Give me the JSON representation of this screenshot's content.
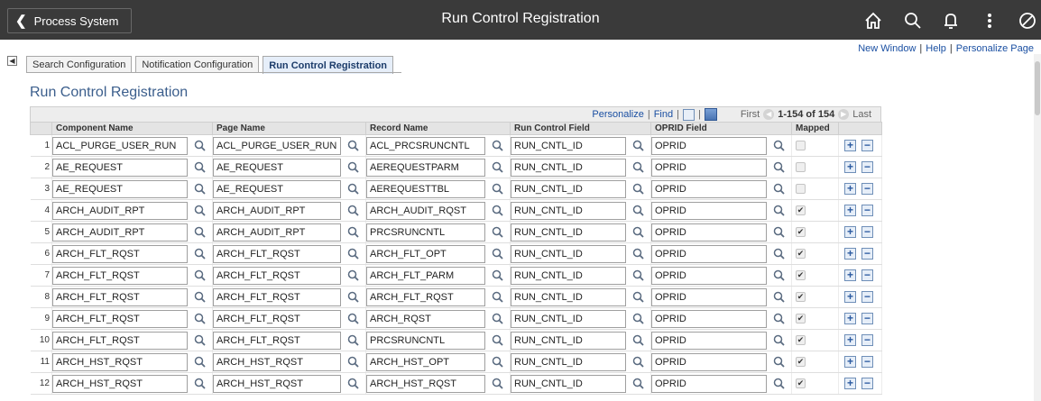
{
  "banner": {
    "back_label": "Process System",
    "title": "Run Control Registration",
    "icons": [
      "home-icon",
      "search-icon",
      "notification-bell-icon",
      "actions-menu-icon",
      "navbar-icon"
    ]
  },
  "page_links": {
    "new_window": "New Window",
    "help": "Help",
    "personalize_page": "Personalize Page"
  },
  "tabs": [
    {
      "label": "Search Configuration",
      "active": false
    },
    {
      "label": "Notification Configuration",
      "active": false
    },
    {
      "label": "Run Control Registration",
      "active": true
    }
  ],
  "heading": "Run Control Registration",
  "grid_nav": {
    "personalize": "Personalize",
    "find": "Find",
    "first": "First",
    "count": "1-154 of 154",
    "last": "Last"
  },
  "columns": [
    "Component Name",
    "Page Name",
    "Record Name",
    "Run Control Field",
    "OPRID Field",
    "Mapped"
  ],
  "rows": [
    {
      "num": "1",
      "component": "ACL_PURGE_USER_RUN",
      "page": "ACL_PURGE_USER_RUN",
      "record": "ACL_PRCSRUNCNTL",
      "runcntl": "RUN_CNTL_ID",
      "oprid": "OPRID",
      "mapped": false
    },
    {
      "num": "2",
      "component": "AE_REQUEST",
      "page": "AE_REQUEST",
      "record": "AEREQUESTPARM",
      "runcntl": "RUN_CNTL_ID",
      "oprid": "OPRID",
      "mapped": false
    },
    {
      "num": "3",
      "component": "AE_REQUEST",
      "page": "AE_REQUEST",
      "record": "AEREQUESTTBL",
      "runcntl": "RUN_CNTL_ID",
      "oprid": "OPRID",
      "mapped": false
    },
    {
      "num": "4",
      "component": "ARCH_AUDIT_RPT",
      "page": "ARCH_AUDIT_RPT",
      "record": "ARCH_AUDIT_RQST",
      "runcntl": "RUN_CNTL_ID",
      "oprid": "OPRID",
      "mapped": true
    },
    {
      "num": "5",
      "component": "ARCH_AUDIT_RPT",
      "page": "ARCH_AUDIT_RPT",
      "record": "PRCSRUNCNTL",
      "runcntl": "RUN_CNTL_ID",
      "oprid": "OPRID",
      "mapped": true
    },
    {
      "num": "6",
      "component": "ARCH_FLT_RQST",
      "page": "ARCH_FLT_RQST",
      "record": "ARCH_FLT_OPT",
      "runcntl": "RUN_CNTL_ID",
      "oprid": "OPRID",
      "mapped": true
    },
    {
      "num": "7",
      "component": "ARCH_FLT_RQST",
      "page": "ARCH_FLT_RQST",
      "record": "ARCH_FLT_PARM",
      "runcntl": "RUN_CNTL_ID",
      "oprid": "OPRID",
      "mapped": true
    },
    {
      "num": "8",
      "component": "ARCH_FLT_RQST",
      "page": "ARCH_FLT_RQST",
      "record": "ARCH_FLT_RQST",
      "runcntl": "RUN_CNTL_ID",
      "oprid": "OPRID",
      "mapped": true
    },
    {
      "num": "9",
      "component": "ARCH_FLT_RQST",
      "page": "ARCH_FLT_RQST",
      "record": "ARCH_RQST",
      "runcntl": "RUN_CNTL_ID",
      "oprid": "OPRID",
      "mapped": true
    },
    {
      "num": "10",
      "component": "ARCH_FLT_RQST",
      "page": "ARCH_FLT_RQST",
      "record": "PRCSRUNCNTL",
      "runcntl": "RUN_CNTL_ID",
      "oprid": "OPRID",
      "mapped": true
    },
    {
      "num": "11",
      "component": "ARCH_HST_RQST",
      "page": "ARCH_HST_RQST",
      "record": "ARCH_HST_OPT",
      "runcntl": "RUN_CNTL_ID",
      "oprid": "OPRID",
      "mapped": true
    },
    {
      "num": "12",
      "component": "ARCH_HST_RQST",
      "page": "ARCH_HST_RQST",
      "record": "ARCH_HST_RQST",
      "runcntl": "RUN_CNTL_ID",
      "oprid": "OPRID",
      "mapped": true
    }
  ],
  "colors": {
    "banner": "#3a3a3a",
    "link": "#1a4fa2",
    "heading": "#3b5e8c"
  }
}
